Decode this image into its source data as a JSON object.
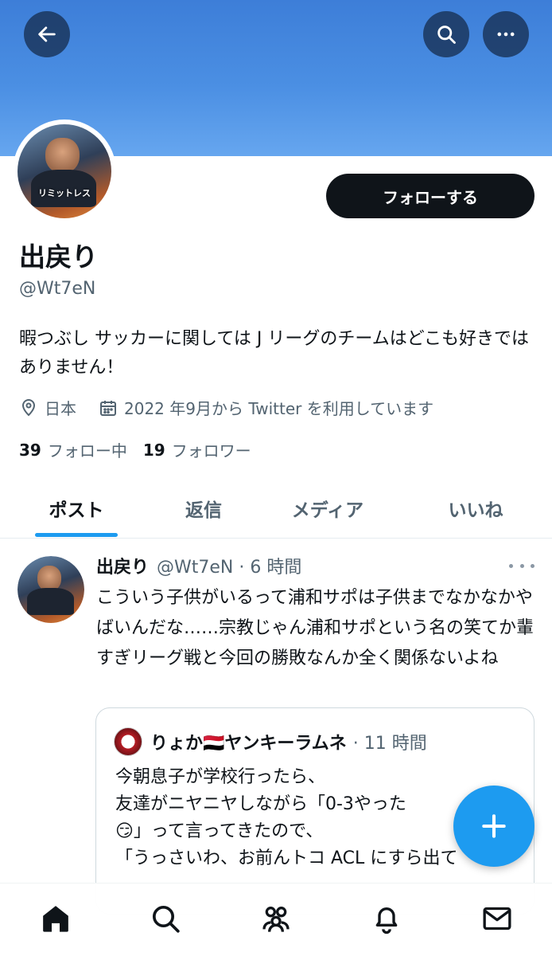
{
  "profile": {
    "follow_label": "フォローする",
    "name": "出戻り",
    "handle": "@Wt7eN",
    "avatar_caption": "リミットレス",
    "bio": "暇つぶし サッカーに関しては J リーグのチームはどこも好きではありません！",
    "location": "日本",
    "joined": "2022 年9月から Twitter を利用しています",
    "following_count": "39",
    "following_label": "フォロー中",
    "followers_count": "19",
    "followers_label": "フォロワー"
  },
  "tabs": [
    "ポスト",
    "返信",
    "メディア",
    "いいね"
  ],
  "post": {
    "name": "出戻り",
    "meta": "@Wt7eN · 6 時間",
    "text": "こういう子供がいるって浦和サポは子供までなかなかやばいんだな……宗教じゃん浦和サポという名の笑てか輩すぎリーグ戦と今回の勝敗なんか全く関係ないよね",
    "quote": {
      "name": "りょか🇾🇪ヤンキーラムネ",
      "meta": "· 11 時間",
      "text": "今朝息子が学校行ったら、\n友達がニヤニヤしながら「0-3やった\n😏」って言ってきたので、\n「うっさいわ、お前んトコ ACL にすら出て"
    }
  },
  "icons": {
    "back": "arrow-left-icon",
    "search": "search-icon",
    "more": "more-horizontal-icon",
    "location": "location-pin-icon",
    "calendar": "calendar-icon",
    "compose": "plus-icon",
    "nav": [
      "home-icon",
      "search-icon",
      "communities-icon",
      "bell-icon",
      "mail-icon"
    ]
  },
  "colors": {
    "accent": "#1d9bf0",
    "banner": "#4b8fe3",
    "text_primary": "#0f1419",
    "text_secondary": "#536471"
  }
}
